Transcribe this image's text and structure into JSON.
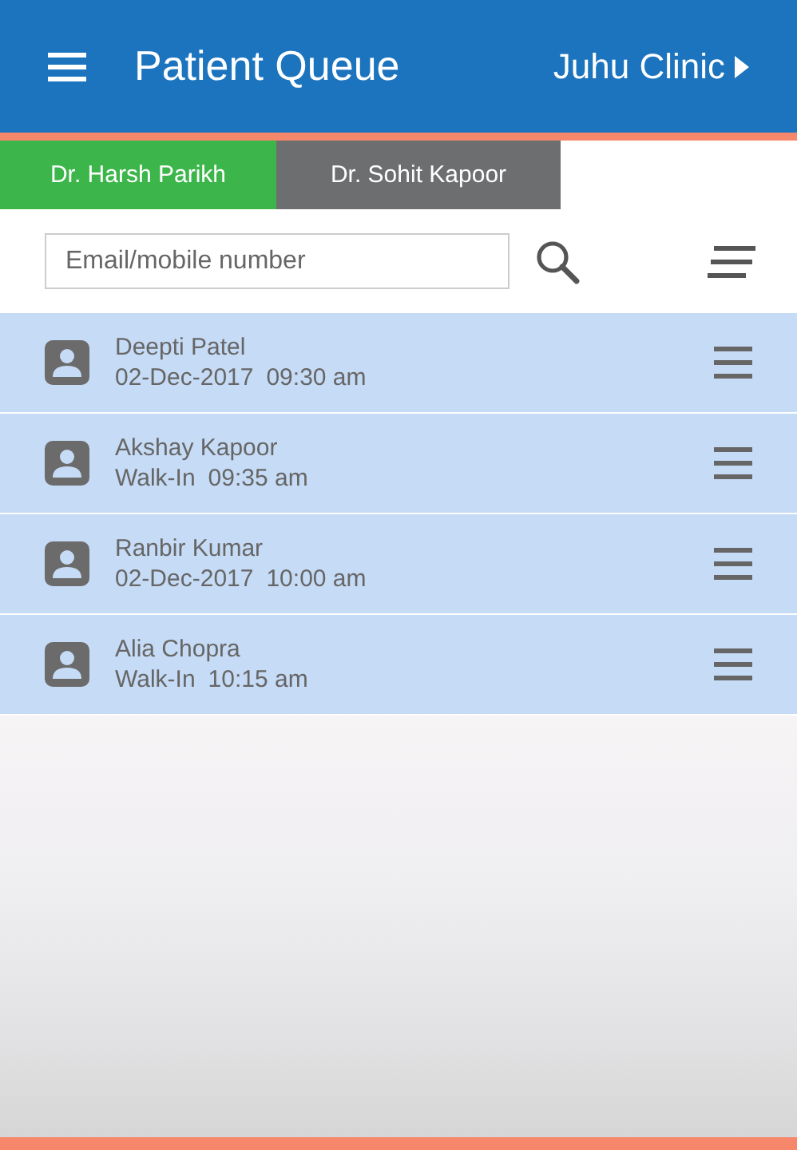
{
  "app_bar": {
    "title": "Patient Queue",
    "clinic": "Juhu Clinic"
  },
  "tabs": [
    {
      "label": "Dr. Harsh Parikh",
      "selected": true
    },
    {
      "label": "Dr. Sohit Kapoor",
      "selected": false
    }
  ],
  "search": {
    "placeholder": "Email/mobile number"
  },
  "patients": [
    {
      "name": "Deepti Patel",
      "visit": "02-Dec-2017",
      "time": "09:30 am"
    },
    {
      "name": "Akshay Kapoor",
      "visit": "Walk-In",
      "time": "09:35 am"
    },
    {
      "name": "Ranbir Kumar",
      "visit": "02-Dec-2017",
      "time": "10:00 am"
    },
    {
      "name": "Alia Chopra",
      "visit": "Walk-In",
      "time": "10:15 am"
    }
  ]
}
